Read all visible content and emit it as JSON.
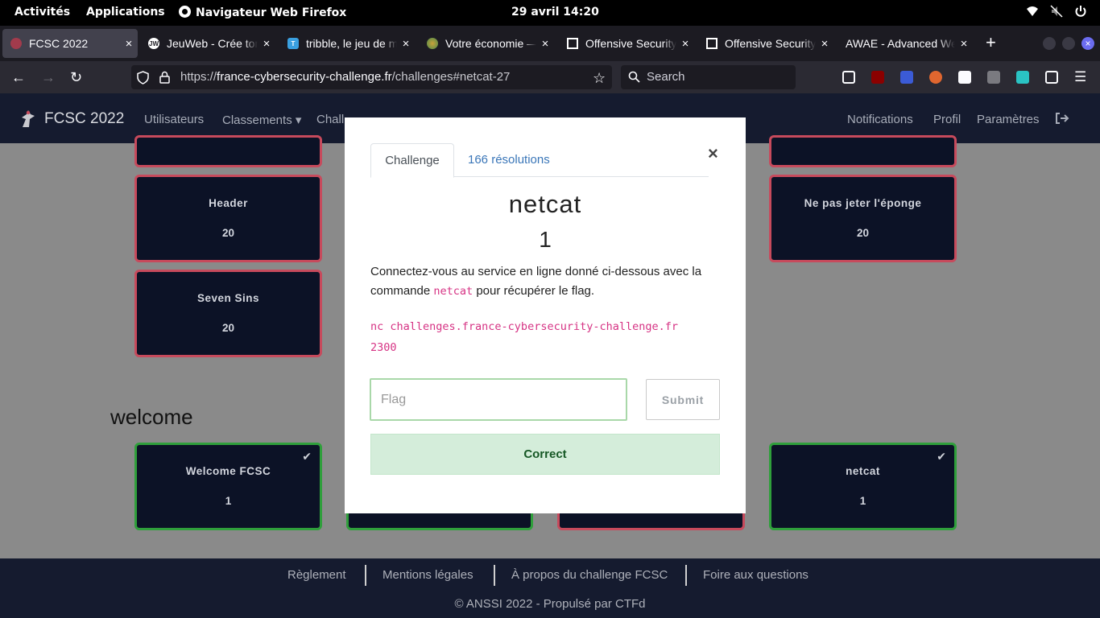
{
  "topbar": {
    "activities": "Activités",
    "applications": "Applications",
    "window_title": "Navigateur Web Firefox",
    "clock": "29 avril  14:20",
    "tray_icons": [
      "wifi-icon",
      "volume-muted-icon",
      "power-icon"
    ]
  },
  "browser": {
    "tabs": [
      {
        "label": "FCSC 2022",
        "favicon_color": "#a23b4c"
      },
      {
        "label": "JeuWeb - Crée ton",
        "favicon_color": "#ffffff",
        "favicon_text": "JW"
      },
      {
        "label": "tribble, le jeu de m",
        "favicon_color": "#3aa0e0",
        "favicon_text": "T"
      },
      {
        "label": "Votre économie —",
        "favicon_color": "#4a8a4a"
      },
      {
        "label": "Offensive Security",
        "favicon_color": "#ffffff"
      },
      {
        "label": "Offensive Security",
        "favicon_color": "#ffffff"
      },
      {
        "label": "AWAE - Advanced We",
        "favicon_color": ""
      }
    ],
    "url_prefix": "https://",
    "url_host": "france-cybersecurity-challenge.fr",
    "url_path": "/challenges#netcat-27",
    "search_placeholder": "Search"
  },
  "site": {
    "brand": "FCSC 2022",
    "nav_left": [
      "Utilisateurs",
      "Classements ▾",
      "Chall"
    ],
    "nav_right": [
      "Notifications",
      "Profil",
      "Paramètres"
    ],
    "cards_top": [
      {
        "name": "Header",
        "value": "20"
      },
      {
        "name": "Ne pas jeter l'éponge",
        "value": "20"
      },
      {
        "name": "Seven Sins",
        "value": "20"
      }
    ],
    "section_title": "welcome",
    "cards_welcome": [
      {
        "name": "Welcome FCSC",
        "value": "1",
        "solved": true
      },
      {
        "name": "netcat",
        "value": "1",
        "solved": true
      }
    ]
  },
  "modal": {
    "tab_challenge": "Challenge",
    "tab_solves": "166 résolutions",
    "close": "×",
    "title": "netcat",
    "value": "1",
    "desc_before": "Connectez-vous au service en ligne donné ci-dessous avec la commande ",
    "desc_code": "netcat",
    "desc_after": " pour récupérer le flag.",
    "command_line1": "nc challenges.france-cybersecurity-challenge.fr",
    "command_line2": "2300",
    "flag_placeholder": "Flag",
    "submit_label": "Submit",
    "result": "Correct"
  },
  "footer": {
    "links": [
      "Règlement",
      "Mentions légales",
      "À propos du challenge FCSC",
      "Foire aux questions"
    ],
    "copyright": "© ANSSI 2022 - Propulsé par CTFd"
  },
  "colors": {
    "accent": "#3a76b8",
    "success": "#155724",
    "unsolved_border": "#c74a5c",
    "solved_border": "#2f9f3b"
  }
}
